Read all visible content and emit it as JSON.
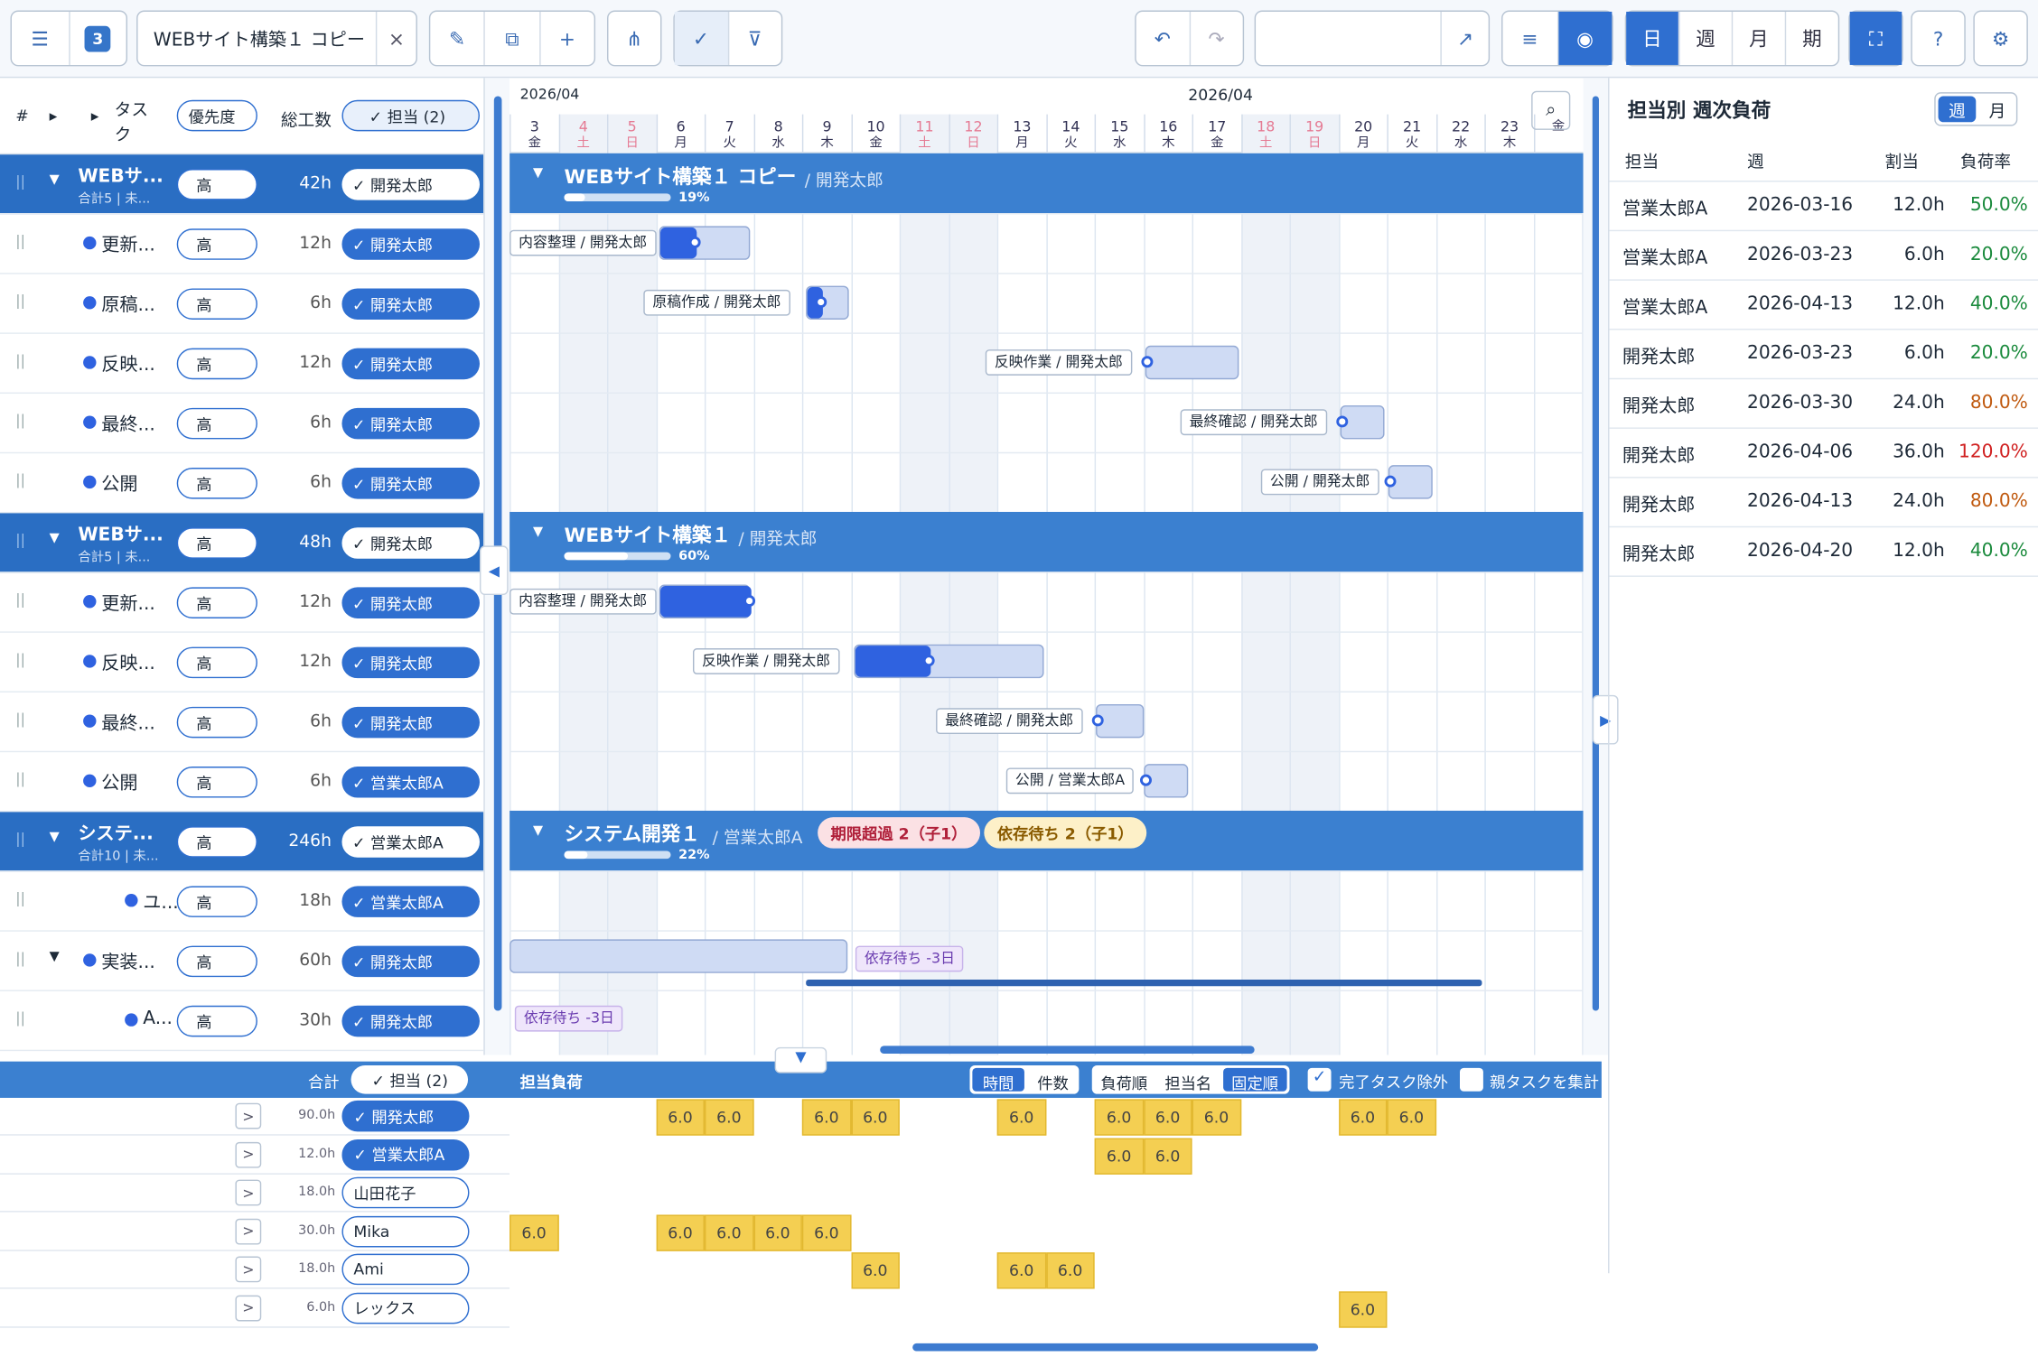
{
  "toolbar": {
    "count": "3",
    "project_name": "WEBサイト構築１ コピー",
    "close": "×",
    "views": [
      "日",
      "週",
      "月",
      "期"
    ]
  },
  "left_header": {
    "hash": "#",
    "tri1": "▸",
    "tri2": "▸",
    "task": "タスク",
    "priority": "優先度",
    "total": "総工数",
    "assignee_filter": "✓ 担当 (2)"
  },
  "rows": [
    {
      "name": "WEBサ...",
      "sub": "合計5 | 未...",
      "prio": "高",
      "hours": "42h",
      "assignee": "✓ 開発太郎",
      "group": true
    },
    {
      "name": "更新...",
      "prio": "高",
      "hours": "12h",
      "assignee": "✓ 開発太郎"
    },
    {
      "name": "原稿...",
      "prio": "高",
      "hours": "6h",
      "assignee": "✓ 開発太郎"
    },
    {
      "name": "反映...",
      "prio": "高",
      "hours": "12h",
      "assignee": "✓ 開発太郎"
    },
    {
      "name": "最終...",
      "prio": "高",
      "hours": "6h",
      "assignee": "✓ 開発太郎"
    },
    {
      "name": "公開",
      "prio": "高",
      "hours": "6h",
      "assignee": "✓ 開発太郎"
    },
    {
      "name": "WEBサ...",
      "sub": "合計5 | 未...",
      "prio": "高",
      "hours": "48h",
      "assignee": "✓ 開発太郎",
      "group": true
    },
    {
      "name": "更新...",
      "prio": "高",
      "hours": "12h",
      "assignee": "✓ 開発太郎"
    },
    {
      "name": "反映...",
      "prio": "高",
      "hours": "12h",
      "assignee": "✓ 開発太郎"
    },
    {
      "name": "最終...",
      "prio": "高",
      "hours": "6h",
      "assignee": "✓ 開発太郎"
    },
    {
      "name": "公開",
      "prio": "高",
      "hours": "6h",
      "assignee": "✓ 営業太郎A"
    },
    {
      "name": "システ...",
      "sub": "合計10 | 未...",
      "prio": "高",
      "hours": "246h",
      "assignee": "✓ 営業太郎A",
      "group": true
    },
    {
      "name": "ユ...",
      "prio": "高",
      "hours": "18h",
      "assignee": "✓ 営業太郎A"
    },
    {
      "name": "実装...",
      "prio": "高",
      "hours": "60h",
      "assignee": "✓ 開発太郎"
    },
    {
      "name": "A...",
      "prio": "高",
      "hours": "30h",
      "assignee": "✓ 開発太郎"
    }
  ],
  "gantt": {
    "month_left": "2026/04",
    "month_center": "2026/04",
    "days": [
      {
        "d": "3",
        "w": "金"
      },
      {
        "d": "4",
        "w": "土"
      },
      {
        "d": "5",
        "w": "日"
      },
      {
        "d": "6",
        "w": "月"
      },
      {
        "d": "7",
        "w": "火"
      },
      {
        "d": "8",
        "w": "水"
      },
      {
        "d": "9",
        "w": "木"
      },
      {
        "d": "10",
        "w": "金"
      },
      {
        "d": "11",
        "w": "土"
      },
      {
        "d": "12",
        "w": "日"
      },
      {
        "d": "13",
        "w": "月"
      },
      {
        "d": "14",
        "w": "火"
      },
      {
        "d": "15",
        "w": "水"
      },
      {
        "d": "16",
        "w": "木"
      },
      {
        "d": "17",
        "w": "金"
      },
      {
        "d": "18",
        "w": "土"
      },
      {
        "d": "19",
        "w": "日"
      },
      {
        "d": "20",
        "w": "月"
      },
      {
        "d": "21",
        "w": "火"
      },
      {
        "d": "22",
        "w": "水"
      },
      {
        "d": "23",
        "w": "木"
      },
      {
        "d": "",
        "w": "金"
      }
    ],
    "groups": [
      {
        "title": "WEBサイト構築１ コピー",
        "owner": "/ 開発太郎",
        "pct": "19%"
      },
      {
        "title": "WEBサイト構築１",
        "owner": "/ 開発太郎",
        "pct": "60%"
      },
      {
        "title": "システム開発１",
        "owner": "/ 営業太郎A",
        "pct": "22%",
        "tag1": "期限超過 2（子1）",
        "tag2": "依存待ち 2（子1）"
      }
    ],
    "labels": [
      "内容整理 / 開発太郎",
      "原稿作成 / 開発太郎",
      "反映作業 / 開発太郎",
      "最終確認 / 開発太郎",
      "公開 / 開発太郎",
      "内容整理 / 開発太郎",
      "反映作業 / 開発太郎",
      "最終確認 / 開発太郎",
      "公開 / 営業太郎A"
    ],
    "wait1": "依存待ち -3日",
    "wait2": "依存待ち -3日"
  },
  "right": {
    "title": "担当別 週次負荷",
    "tab_week": "週",
    "tab_month": "月",
    "cols": [
      "担当",
      "週",
      "割当",
      "負荷率"
    ],
    "rows": [
      {
        "who": "営業太郎A",
        "week": "2026-03-16",
        "hours": "12.0h",
        "rate": "50.0%",
        "color": "#1a8a3c"
      },
      {
        "who": "営業太郎A",
        "week": "2026-03-23",
        "hours": "6.0h",
        "rate": "20.0%",
        "color": "#1a8a3c"
      },
      {
        "who": "営業太郎A",
        "week": "2026-04-13",
        "hours": "12.0h",
        "rate": "40.0%",
        "color": "#1a8a3c"
      },
      {
        "who": "開発太郎",
        "week": "2026-03-23",
        "hours": "6.0h",
        "rate": "20.0%",
        "color": "#1a8a3c"
      },
      {
        "who": "開発太郎",
        "week": "2026-03-30",
        "hours": "24.0h",
        "rate": "80.0%",
        "color": "#c05a10"
      },
      {
        "who": "開発太郎",
        "week": "2026-04-06",
        "hours": "36.0h",
        "rate": "120.0%",
        "color": "#d02020"
      },
      {
        "who": "開発太郎",
        "week": "2026-04-13",
        "hours": "24.0h",
        "rate": "80.0%",
        "color": "#c05a10"
      },
      {
        "who": "開発太郎",
        "week": "2026-04-20",
        "hours": "12.0h",
        "rate": "40.0%",
        "color": "#1a8a3c"
      }
    ]
  },
  "bottom": {
    "total": "合計",
    "filter": "✓ 担当 (2)",
    "title": "担当負荷",
    "seg1": [
      "時間",
      "件数"
    ],
    "seg2": [
      "負荷順",
      "担当名",
      "固定順"
    ],
    "chk1": "完了タスク除外",
    "chk2": "親タスクを集計",
    "people": [
      {
        "hours": "90.0h",
        "name": "✓ 開発太郎",
        "sel": true,
        "cells": [
          [
            3,
            "6.0"
          ],
          [
            4,
            "6.0"
          ],
          [
            6,
            "6.0"
          ],
          [
            7,
            "6.0"
          ],
          [
            10,
            "6.0"
          ],
          [
            12,
            "6.0"
          ],
          [
            13,
            "6.0"
          ],
          [
            14,
            "6.0"
          ],
          [
            17,
            "6.0"
          ],
          [
            18,
            "6.0"
          ]
        ]
      },
      {
        "hours": "12.0h",
        "name": "✓ 営業太郎A",
        "sel": true,
        "cells": [
          [
            12,
            "6.0"
          ],
          [
            13,
            "6.0"
          ]
        ]
      },
      {
        "hours": "18.0h",
        "name": "山田花子",
        "sel": false,
        "cells": []
      },
      {
        "hours": "30.0h",
        "name": "Mika",
        "sel": false,
        "cells": [
          [
            0,
            "6.0"
          ],
          [
            3,
            "6.0"
          ],
          [
            4,
            "6.0"
          ],
          [
            5,
            "6.0"
          ],
          [
            6,
            "6.0"
          ]
        ]
      },
      {
        "hours": "18.0h",
        "name": "Ami",
        "sel": false,
        "cells": [
          [
            7,
            "6.0"
          ],
          [
            10,
            "6.0"
          ],
          [
            11,
            "6.0"
          ]
        ]
      },
      {
        "hours": "6.0h",
        "name": "レックス",
        "sel": false,
        "cells": [
          [
            17,
            "6.0"
          ]
        ]
      }
    ]
  }
}
